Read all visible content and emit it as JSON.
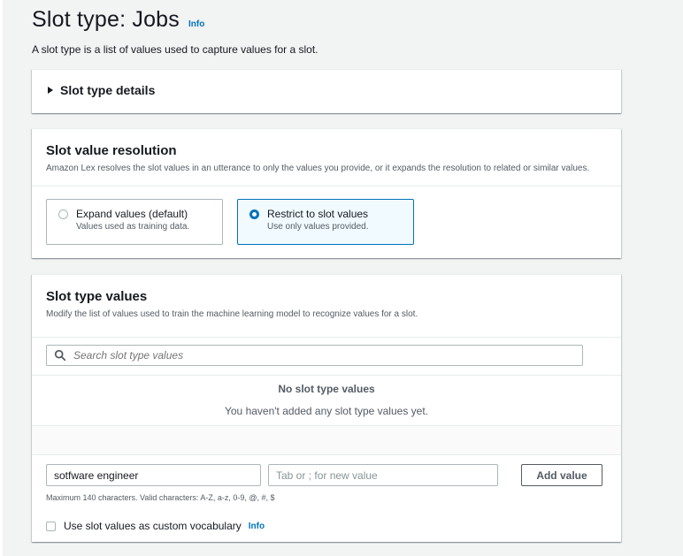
{
  "header": {
    "title": "Slot type: Jobs",
    "info_link": "Info",
    "description": "A slot type is a list of values used to capture values for a slot."
  },
  "details_panel": {
    "label": "Slot type details",
    "expanded": false
  },
  "resolution_panel": {
    "title": "Slot value resolution",
    "description": "Amazon Lex resolves the slot values in an utterance to only the values you provide, or it expands the resolution to related or similar values.",
    "options": [
      {
        "label": "Expand values (default)",
        "sublabel": "Values used as training data.",
        "selected": false
      },
      {
        "label": "Restrict to slot values",
        "sublabel": "Use only values provided.",
        "selected": true
      }
    ]
  },
  "values_panel": {
    "title": "Slot type values",
    "description": "Modify the list of values used to train the machine learning model to recognize values for a slot.",
    "search_placeholder": "Search slot type values",
    "empty_title": "No slot type values",
    "empty_message": "You haven't added any slot type values yet.",
    "value_input": "sotfware engineer",
    "synonym_placeholder": "Tab or ; for new value",
    "add_button": "Add value",
    "hint": "Maximum 140 characters. Valid characters: A-Z, a-z, 0-9, @, #, $",
    "vocab_checkbox_label": "Use slot values as custom vocabulary",
    "vocab_checked": false,
    "vocab_info": "Info"
  },
  "colors": {
    "link": "#0073bb",
    "selected_tile_bg": "#f1faff",
    "page_bg": "#f2f3f3"
  }
}
